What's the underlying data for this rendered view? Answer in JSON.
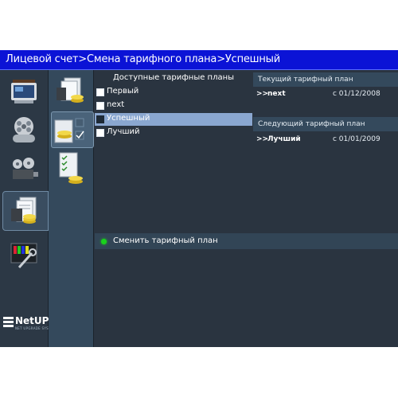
{
  "breadcrumb": "Лицевой счет>Смена тарифного плана>Успешный",
  "plans": {
    "header": "Доступные тарифные планы",
    "items": [
      {
        "label": "Первый",
        "selected": false
      },
      {
        "label": "next",
        "selected": false
      },
      {
        "label": "Успешный",
        "selected": true
      },
      {
        "label": "Лучший",
        "selected": false
      }
    ]
  },
  "current_plan": {
    "header": "Текущий тарифный план",
    "arrow": ">>",
    "name": "next",
    "date": "с 01/12/2008"
  },
  "next_plan": {
    "header": "Следующий тарифный план",
    "arrow": ">>",
    "name": "Лучший",
    "date": "с 01/01/2009"
  },
  "action": {
    "label": "Сменить тарифный план",
    "status_color": "#19d21c"
  },
  "logo": {
    "text": "NetUP",
    "tagline": "NET UPGRADE SYSTEMS"
  },
  "sidebar_icons": [
    "tv-icon",
    "film-reels-icon",
    "projector-icon",
    "documents-coins-icon",
    "tools-screen-icon"
  ],
  "subnav_icons": [
    "documents-coins-icon",
    "checklist-coins-icon",
    "checklist-plan-icon"
  ],
  "colors": {
    "titlebar": "#0b13d6",
    "background": "#2a3440",
    "selection": "#8aa7d0"
  }
}
